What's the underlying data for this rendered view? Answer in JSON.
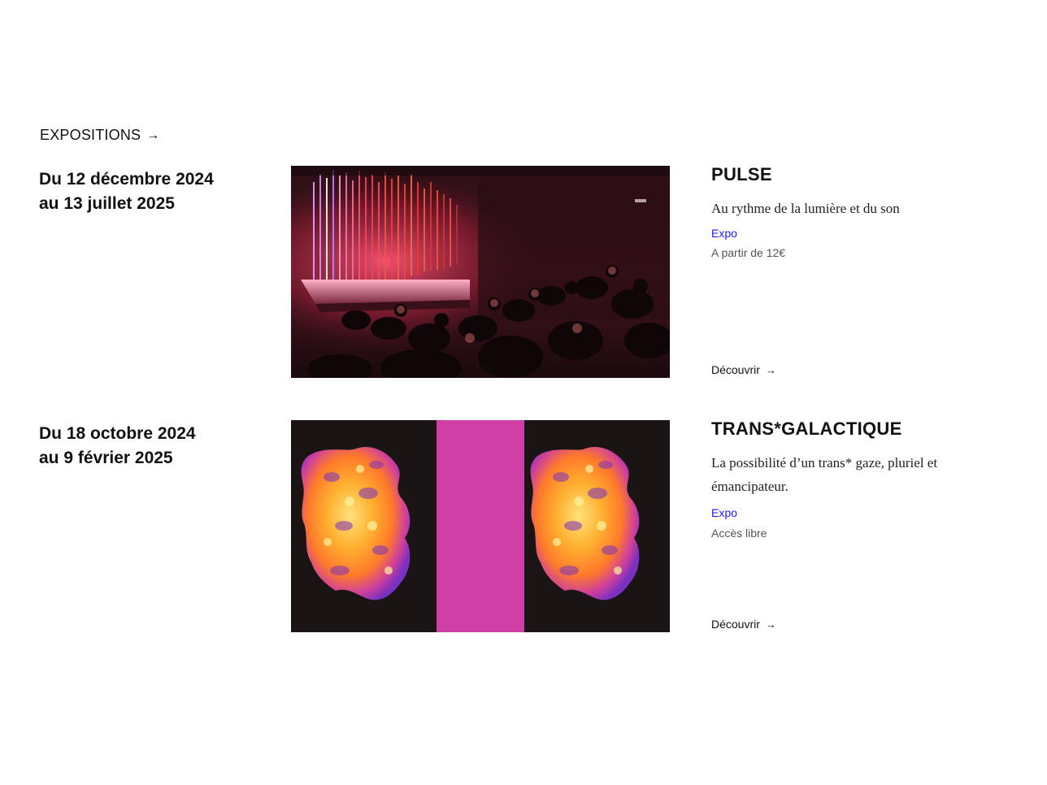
{
  "section": {
    "label": "EXPOSITIONS",
    "arrow_icon": "arrow-right-icon"
  },
  "events": [
    {
      "dates": [
        "Du 12 décembre 2024",
        "au 13 juillet 2025"
      ],
      "title": "PULSE",
      "subtitle": "Au rythme de la lumière et du son",
      "category": "Expo",
      "price": "A partir de 12€",
      "cta": "Découvrir",
      "image_description_icon": "light-installation-image"
    },
    {
      "dates": [
        "Du 18 octobre 2024",
        "au 9 février 2025"
      ],
      "title": "TRANS*GALACTIQUE",
      "subtitle": "La possibilité d’un trans* gaze, pluriel et émancipateur.",
      "category": "Expo",
      "price": "Accès libre",
      "cta": "Découvrir",
      "image_description_icon": "thermal-bodies-image"
    }
  ],
  "colors": {
    "link_blue": "#1a1aff",
    "pink_band": "#d03fa6",
    "image_dark": "#1a1414"
  }
}
